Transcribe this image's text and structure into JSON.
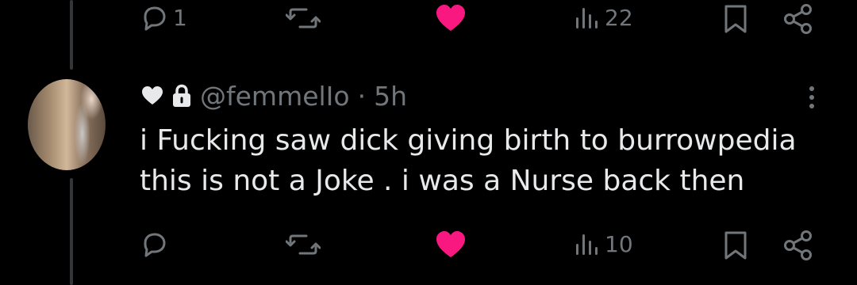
{
  "top_actions": {
    "reply_count": "1",
    "views_count": "22"
  },
  "reply": {
    "handle": "@femmelIo",
    "separator": "·",
    "time": "5h",
    "text_lines": [
      "i Fucking saw dick giving birth to burrowpedia",
      "this is not a Joke . i was a Nurse back then"
    ]
  },
  "bottom_actions": {
    "views_count": "10"
  },
  "colors": {
    "background": "#000000",
    "text": "#e7e9ea",
    "muted": "#71767b",
    "like": "#f91880",
    "thread_line": "#333639"
  },
  "icons": [
    "reply-icon",
    "repost-icon",
    "like-icon",
    "views-icon",
    "bookmark-icon",
    "share-icon",
    "heart-badge-icon",
    "lock-icon",
    "more-icon"
  ]
}
